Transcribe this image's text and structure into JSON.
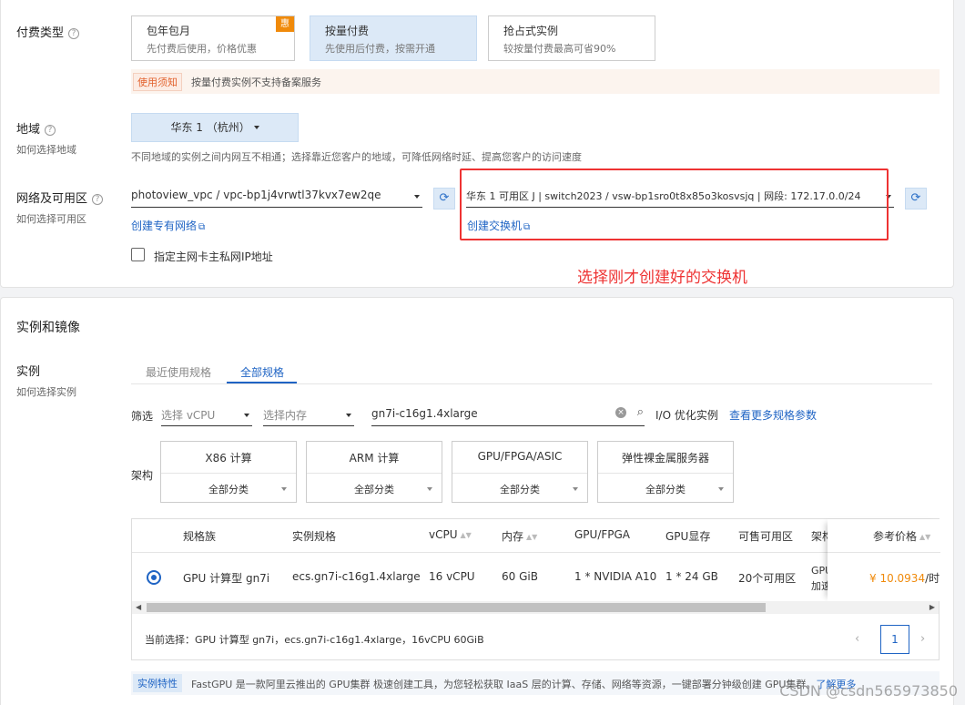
{
  "billing": {
    "label": "付费类型",
    "options": [
      {
        "title": "包年包月",
        "desc": "先付费后使用，价格优惠",
        "badge": "惠"
      },
      {
        "title": "按量付费",
        "desc": "先使用后付费，按需开通"
      },
      {
        "title": "抢占式实例",
        "desc": "较按量付费最高可省90%"
      }
    ],
    "notice_tag": "使用须知",
    "notice_text": "按量付费实例不支持备案服务"
  },
  "region": {
    "label": "地域",
    "sublabel": "如何选择地域",
    "selected": "华东 1 （杭州）",
    "hint": "不同地域的实例之间内网互不相通；选择靠近您客户的地域，可降低网络时延、提高您客户的访问速度"
  },
  "network": {
    "label": "网络及可用区",
    "sublabel": "如何选择可用区",
    "vpc_value": "photoview_vpc / vpc-bp1j4vrwtl37kvx7ew2qe",
    "create_vpc": "创建专有网络",
    "vswitch_value": "华东 1 可用区 J | switch2023 / vsw-bp1sro0t8x85o3kosvsjq | 网段: 172.17.0.0/24",
    "create_vswitch": "创建交换机",
    "private_ip_label": "指定主网卡主私网IP地址",
    "annotation": "选择刚才创建好的交换机"
  },
  "instance": {
    "section_title": "实例和镜像",
    "label": "实例",
    "sublabel": "如何选择实例",
    "tabs": [
      "最近使用规格",
      "全部规格"
    ],
    "filter_label": "筛选",
    "vcpu_placeholder": "选择 vCPU",
    "mem_placeholder": "选择内存",
    "search_value": "gn7i-c16g1.4xlarge",
    "io_label": "I/O 优化实例",
    "more_link": "查看更多规格参数",
    "arch_label": "架构",
    "arch": [
      {
        "title": "X86 计算",
        "sub": "全部分类"
      },
      {
        "title": "ARM 计算",
        "sub": "全部分类"
      },
      {
        "title": "GPU/FPGA/ASIC",
        "sub": "全部分类"
      },
      {
        "title": "弹性裸金属服务器",
        "sub": "全部分类"
      }
    ],
    "table": {
      "headers": [
        "规格族",
        "实例规格",
        "vCPU",
        "内存",
        "GPU/FPGA",
        "GPU显存",
        "可售可用区",
        "架构",
        "参考价格"
      ],
      "row": {
        "family": "GPU 计算型 gn7i",
        "spec": "ecs.gn7i-c16g1.4xlarge",
        "vcpu": "16 vCPU",
        "mem": "60 GiB",
        "gpu": "1 * NVIDIA A10",
        "gpu_mem": "1 * 24 GB",
        "zones": "20个可用区",
        "arch_l1": "GPU",
        "arch_l2": "加速",
        "price": "¥ 10.0934",
        "price_unit": "/时"
      }
    },
    "current": "当前选择：GPU 计算型 gn7i，ecs.gn7i-c16g1.4xlarge，16vCPU 60GiB",
    "page": "1",
    "feature_tag": "实例特性",
    "feature_text": "FastGPU 是一款阿里云推出的 GPU集群 极速创建工具，为您轻松获取 IaaS 层的计算、存储、网络等资源，一键部署分钟级创建 GPU集群。",
    "feature_more": "了解更多",
    "watermark": "CSDN @csdn565973850"
  }
}
